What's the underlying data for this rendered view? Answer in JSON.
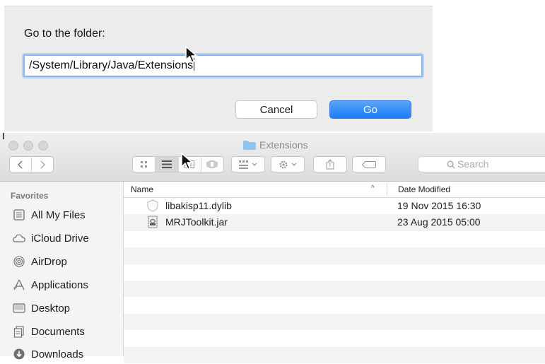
{
  "goto_sheet": {
    "title": "Go to the folder:",
    "path_value": "/System/Library/Java/Extensions",
    "cancel_label": "Cancel",
    "go_label": "Go",
    "accent_color": "#1c7cf5"
  },
  "finder": {
    "window_title": "Extensions",
    "search_placeholder": "Search",
    "sidebar": {
      "heading": "Favorites",
      "items": [
        {
          "label": "All My Files",
          "icon": "all-files-icon"
        },
        {
          "label": "iCloud Drive",
          "icon": "cloud-icon"
        },
        {
          "label": "AirDrop",
          "icon": "airdrop-icon"
        },
        {
          "label": "Applications",
          "icon": "applications-icon"
        },
        {
          "label": "Desktop",
          "icon": "desktop-icon"
        },
        {
          "label": "Documents",
          "icon": "documents-icon"
        },
        {
          "label": "Downloads",
          "icon": "downloads-icon"
        }
      ]
    },
    "columns": {
      "name": "Name",
      "date_modified": "Date Modified",
      "sort_indicator": "^"
    },
    "files": [
      {
        "name": "libakisp11.dylib",
        "date": "19 Nov 2015 16:30",
        "icon": "dylib-icon"
      },
      {
        "name": "MRJToolkit.jar",
        "date": "23 Aug 2015 05:00",
        "icon": "jar-icon"
      }
    ]
  }
}
